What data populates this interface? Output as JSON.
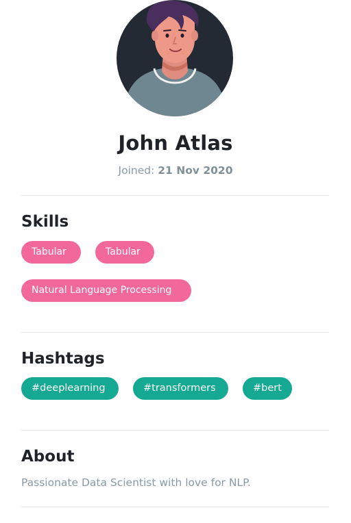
{
  "profile": {
    "name": "John Atlas",
    "joined_label": "Joined:",
    "joined_date": "21 Nov 2020"
  },
  "skills": {
    "title": "Skills",
    "items": [
      "Tabular",
      "Tabular",
      "Natural Language Processing"
    ]
  },
  "hashtags": {
    "title": "Hashtags",
    "items": [
      "#deeplearning",
      "#transformers",
      "#bert"
    ]
  },
  "about": {
    "title": "About",
    "text": "Passionate Data Scientist with love for NLP."
  },
  "colors": {
    "skill_pill": "#f2689b",
    "hashtag_pill": "#15a892",
    "muted_text": "#8a9aa3",
    "avatar_bg": "#232a33"
  },
  "icons": {
    "avatar": "person-illustration-avatar"
  }
}
